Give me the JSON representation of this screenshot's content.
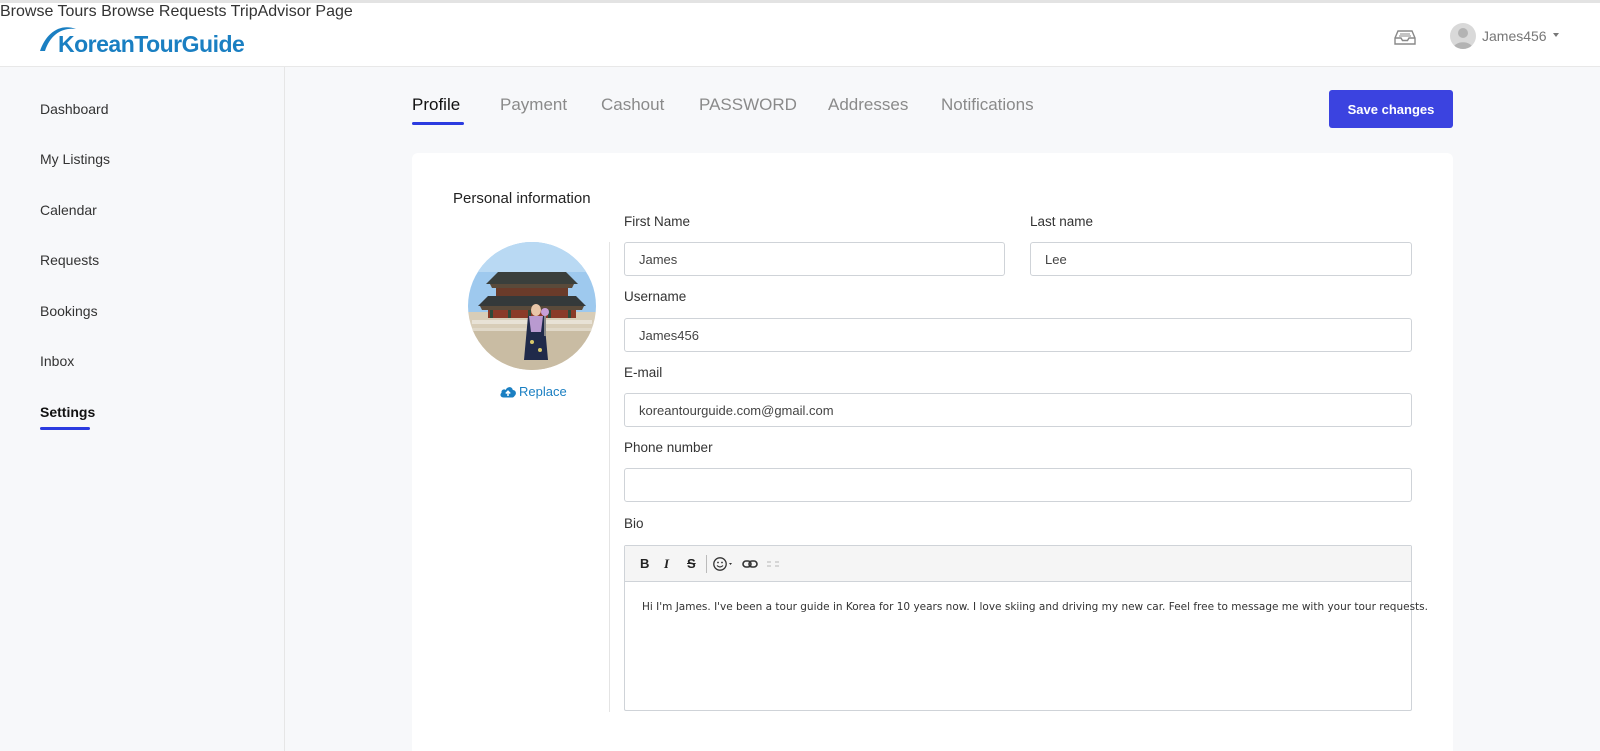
{
  "brand": {
    "name": "KoreanTourGuide",
    "color": "#1a7fc2"
  },
  "topnav": {
    "browse_tours": "Browse Tours",
    "browse_requests": "Browse Requests",
    "tripadvisor": "TripAdvisor Page",
    "inbox_icon": "inbox-tray-icon",
    "username": "James456"
  },
  "sidebar": {
    "items": [
      {
        "label": "Dashboard",
        "active": false
      },
      {
        "label": "My Listings",
        "active": false
      },
      {
        "label": "Calendar",
        "active": false
      },
      {
        "label": "Requests",
        "active": false
      },
      {
        "label": "Bookings",
        "active": false
      },
      {
        "label": "Inbox",
        "active": false
      },
      {
        "label": "Settings",
        "active": true
      }
    ]
  },
  "tabs": [
    {
      "label": "Profile",
      "active": true
    },
    {
      "label": "Payment",
      "active": false
    },
    {
      "label": "Cashout",
      "active": false
    },
    {
      "label": "PASSWORD",
      "active": false
    },
    {
      "label": "Addresses",
      "active": false
    },
    {
      "label": "Notifications",
      "active": false
    }
  ],
  "save_button": "Save changes",
  "accent_color": "#3b43e0",
  "personal": {
    "title": "Personal information",
    "replace_label": "Replace",
    "first_name_label": "First Name",
    "first_name": "James",
    "last_name_label": "Last name",
    "last_name": "Lee",
    "username_label": "Username",
    "username": "James456",
    "email_label": "E-mail",
    "email": "koreantourguide.com@gmail.com",
    "phone_label": "Phone number",
    "phone": "",
    "bio_label": "Bio",
    "bio": "Hi I'm James. I've been a tour guide in Korea for 10 years now. I love skiing and driving my new car. Feel free to message me with your tour requests."
  },
  "editor_toolbar": {
    "bold": "B",
    "italic": "I",
    "strike": "S",
    "emoji_icon": "emoji-icon",
    "link_icon": "link-icon",
    "unlink_icon": "unlink-icon"
  }
}
